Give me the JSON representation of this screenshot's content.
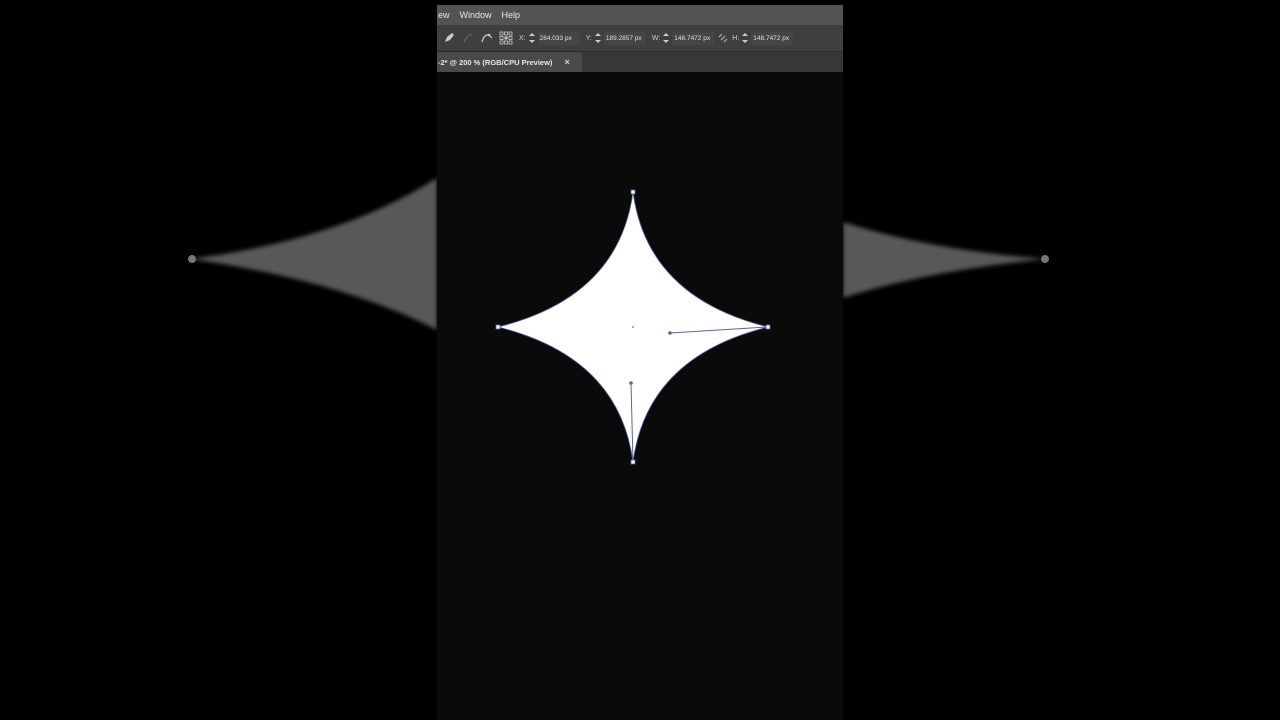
{
  "menubar": {
    "items": [
      "ew",
      "Window",
      "Help"
    ]
  },
  "toolbar": {
    "x_label": "X:",
    "x_value": "284.033 px",
    "y_label": "Y:",
    "y_value": "189.2857 px",
    "w_label": "W:",
    "w_value": "148.7472 px",
    "h_label": "H:",
    "h_value": "148.7472 px",
    "icons": [
      "pen-icon",
      "anchor-icon",
      "smooth-icon",
      "reference-point-icon",
      "link-icon"
    ]
  },
  "document_tab": {
    "title": "-2* @ 200 % (RGB/CPU Preview)",
    "close": "×"
  },
  "colors": {
    "menubar": "#535353",
    "toolbar": "#3f3f3f",
    "canvas": "#0a0a0b",
    "shape_fill": "#ffffff",
    "path_stroke": "#5a63a8"
  }
}
